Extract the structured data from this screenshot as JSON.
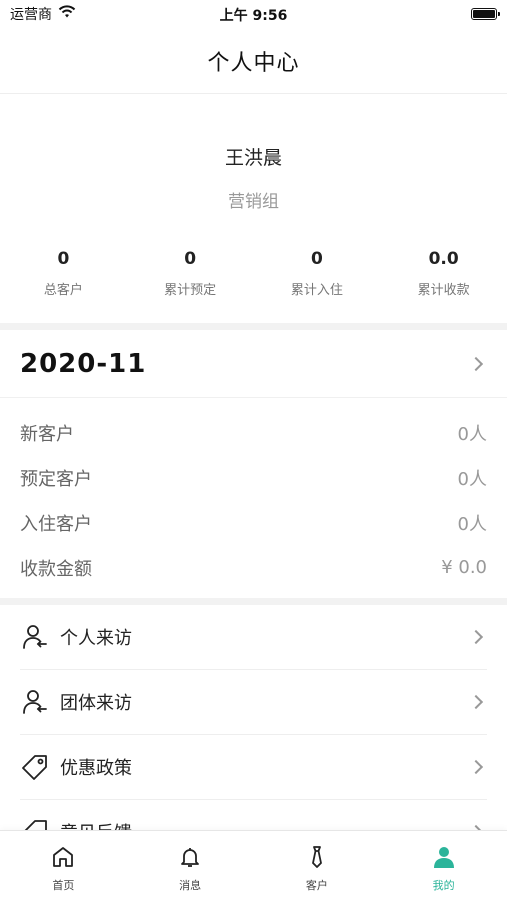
{
  "status_bar": {
    "carrier": "运营商",
    "time": "上午 9:56"
  },
  "nav": {
    "title": "个人中心"
  },
  "profile": {
    "name": "王洪晨",
    "group": "营销组",
    "stats": [
      {
        "value": "0",
        "label": "总客户"
      },
      {
        "value": "0",
        "label": "累计预定"
      },
      {
        "value": "0",
        "label": "累计入住"
      },
      {
        "value": "0.0",
        "label": "累计收款"
      }
    ]
  },
  "month": {
    "title": "2020-11",
    "rows": [
      {
        "label": "新客户",
        "value": "0人"
      },
      {
        "label": "预定客户",
        "value": "0人"
      },
      {
        "label": "入住客户",
        "value": "0人"
      },
      {
        "label": "收款金额",
        "value": "¥ 0.0"
      }
    ]
  },
  "menu": {
    "items": [
      {
        "label": "个人来访",
        "icon": "person-return-icon"
      },
      {
        "label": "团体来访",
        "icon": "group-return-icon"
      },
      {
        "label": "优惠政策",
        "icon": "tag-icon"
      },
      {
        "label": "意见反馈",
        "icon": "feedback-icon"
      }
    ]
  },
  "tabs": [
    {
      "label": "首页",
      "icon": "home-icon"
    },
    {
      "label": "消息",
      "icon": "bell-icon"
    },
    {
      "label": "客户",
      "icon": "tie-icon"
    },
    {
      "label": "我的",
      "icon": "user-icon",
      "active": true
    }
  ],
  "colors": {
    "accent": "#2bb49a",
    "divider": "#f2f2f2",
    "muted": "#999999"
  }
}
